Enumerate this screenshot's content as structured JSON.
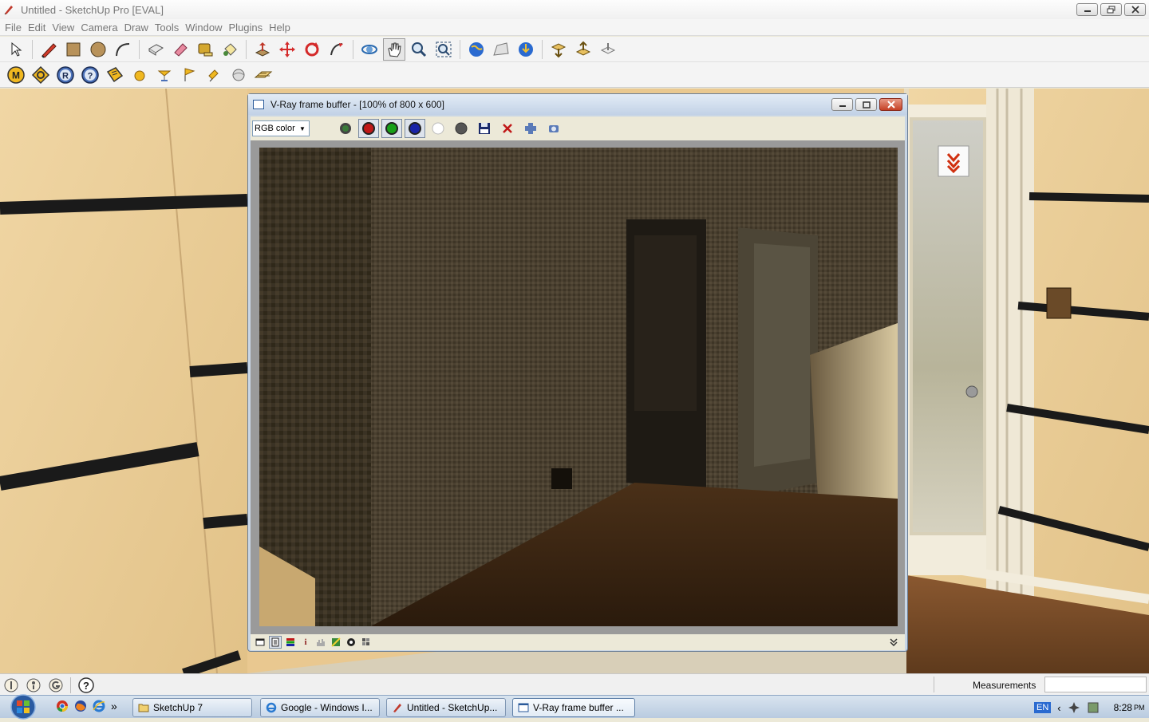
{
  "window": {
    "title": "Untitled - SketchUp Pro [EVAL]",
    "controls": [
      "minimize",
      "restore",
      "close"
    ]
  },
  "menu": [
    "File",
    "Edit",
    "View",
    "Camera",
    "Draw",
    "Tools",
    "Window",
    "Plugins",
    "Help"
  ],
  "toolbar_main": [
    {
      "name": "select-tool-icon"
    },
    {
      "name": "pencil-tool-icon"
    },
    {
      "name": "rectangle-tool-icon"
    },
    {
      "name": "circle-tool-icon"
    },
    {
      "name": "arc-tool-icon"
    },
    {
      "name": "make-component-icon"
    },
    {
      "name": "eraser-tool-icon"
    },
    {
      "name": "tape-measure-icon"
    },
    {
      "name": "paint-bucket-icon"
    },
    {
      "name": "push-pull-icon"
    },
    {
      "name": "move-tool-icon"
    },
    {
      "name": "rotate-tool-icon"
    },
    {
      "name": "follow-me-icon"
    },
    {
      "name": "orbit-tool-icon"
    },
    {
      "name": "pan-tool-icon"
    },
    {
      "name": "zoom-tool-icon"
    },
    {
      "name": "zoom-extents-icon"
    },
    {
      "name": "google-earth-icon"
    },
    {
      "name": "toggle-terrain-icon"
    },
    {
      "name": "place-model-icon"
    },
    {
      "name": "get-models-icon"
    },
    {
      "name": "share-model-icon"
    },
    {
      "name": "share-component-icon"
    }
  ],
  "toolbar_vray": [
    {
      "name": "vray-material-editor-icon",
      "label": "M"
    },
    {
      "name": "vray-options-icon"
    },
    {
      "name": "vray-render-icon",
      "label": "R"
    },
    {
      "name": "vray-help-icon",
      "label": "?"
    },
    {
      "name": "vray-frame-buffer-icon"
    },
    {
      "name": "vray-sphere-light-icon"
    },
    {
      "name": "vray-spot-light-icon"
    },
    {
      "name": "vray-omni-light-icon"
    },
    {
      "name": "vray-ies-light-icon"
    },
    {
      "name": "vray-dome-light-icon"
    },
    {
      "name": "vray-infinite-plane-icon"
    }
  ],
  "vfb": {
    "title": "V-Ray frame buffer - [100% of 800 x 600]",
    "channel_select": "RGB color",
    "toolbar": [
      {
        "name": "rgb-channel-icon",
        "color": "#3a7a3a"
      },
      {
        "name": "red-channel-icon",
        "color": "#c01818"
      },
      {
        "name": "green-channel-icon",
        "color": "#18a018"
      },
      {
        "name": "blue-channel-icon",
        "color": "#1a24a8"
      },
      {
        "name": "alpha-channel-icon",
        "color": "#ffffff"
      },
      {
        "name": "monochrome-icon",
        "color": "#555555"
      },
      {
        "name": "save-image-icon"
      },
      {
        "name": "clear-image-icon"
      },
      {
        "name": "track-mouse-icon"
      },
      {
        "name": "duplicate-vfb-icon"
      }
    ],
    "statusbar": [
      {
        "name": "show-corrections-icon"
      },
      {
        "name": "use-colour-level-icon"
      },
      {
        "name": "use-colour-curve-icon"
      },
      {
        "name": "info-icon",
        "label": "i"
      },
      {
        "name": "histogram-icon"
      },
      {
        "name": "lut-icon"
      },
      {
        "name": "srgb-icon"
      },
      {
        "name": "pixel-info-icon"
      }
    ],
    "expand_icon": "chevron-double-down-icon"
  },
  "status": {
    "measurements_label": "Measurements",
    "measurements_value": ""
  },
  "taskbar": {
    "start": "windows-start-icon",
    "quicklaunch": [
      "chrome-icon",
      "firefox-icon",
      "internet-explorer-icon"
    ],
    "quicklaunch_more": "»",
    "buttons": [
      {
        "label": "SketchUp 7",
        "icon": "folder-icon"
      },
      {
        "label": "Google - Windows I...",
        "icon": "ie-icon"
      },
      {
        "label": "Untitled - SketchUp...",
        "icon": "sketchup-icon"
      },
      {
        "label": "V-Ray frame buffer ...",
        "icon": "vfb-window-icon"
      }
    ],
    "tray": {
      "language": "EN",
      "time": "8:28",
      "ampm": "PM"
    }
  }
}
